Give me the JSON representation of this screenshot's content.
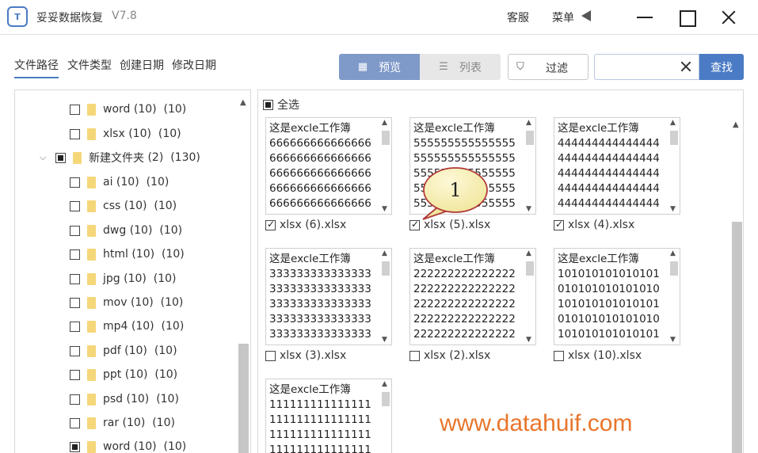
{
  "app": {
    "name": "妥妥数据恢复",
    "version": "V7.8",
    "logo_text": "T",
    "service": "客服",
    "menu": "菜单"
  },
  "tabs": [
    {
      "label": "文件路径"
    },
    {
      "label": "文件类型"
    },
    {
      "label": "创建日期"
    },
    {
      "label": "修改日期"
    }
  ],
  "toolbar": {
    "preview_label": "预览",
    "list_label": "列表",
    "filter_label": "过滤",
    "search_value": "",
    "search_label": "查找"
  },
  "tree": [
    {
      "name": "word",
      "count": "(10)",
      "total": "(10)"
    },
    {
      "name": "xlsx",
      "count": "(10)",
      "total": "(10)"
    },
    {
      "name": "新建文件夹",
      "count": "(2)",
      "total": "(130)"
    },
    {
      "name": "ai",
      "count": "(10)",
      "total": "(10)"
    },
    {
      "name": "css",
      "count": "(10)",
      "total": "(10)"
    },
    {
      "name": "dwg",
      "count": "(10)",
      "total": "(10)"
    },
    {
      "name": "html",
      "count": "(10)",
      "total": "(10)"
    },
    {
      "name": "jpg",
      "count": "(10)",
      "total": "(10)"
    },
    {
      "name": "mov",
      "count": "(10)",
      "total": "(10)"
    },
    {
      "name": "mp4",
      "count": "(10)",
      "total": "(10)"
    },
    {
      "name": "pdf",
      "count": "(10)",
      "total": "(10)"
    },
    {
      "name": "ppt",
      "count": "(10)",
      "total": "(10)"
    },
    {
      "name": "psd",
      "count": "(10)",
      "total": "(10)"
    },
    {
      "name": "rar",
      "count": "(10)",
      "total": "(10)"
    },
    {
      "name": "word",
      "count": "(10)",
      "total": "(10)"
    }
  ],
  "select_all_label": "全选",
  "files": [
    {
      "header": "这是excle工作簿",
      "lines": [
        "666666666666666",
        "666666666666666",
        "666666666666666",
        "666666666666666",
        "666666666666666"
      ],
      "name": "xlsx (6).xlsx",
      "checked": true
    },
    {
      "header": "这是excle工作簿",
      "lines": [
        "555555555555555",
        "555555555555555",
        "555555555555555",
        "555555555555555",
        "555555555555555"
      ],
      "name": "xlsx (5).xlsx",
      "checked": true
    },
    {
      "header": "这是excle工作簿",
      "lines": [
        "444444444444444",
        "444444444444444",
        "444444444444444",
        "444444444444444",
        "444444444444444"
      ],
      "name": "xlsx (4).xlsx",
      "checked": true
    },
    {
      "header": "这是excle工作簿",
      "lines": [
        "333333333333333",
        "333333333333333",
        "333333333333333",
        "333333333333333",
        "333333333333333"
      ],
      "name": "xlsx (3).xlsx",
      "checked": false
    },
    {
      "header": "这是excle工作簿",
      "lines": [
        "222222222222222",
        "222222222222222",
        "222222222222222",
        "222222222222222",
        "222222222222222"
      ],
      "name": "xlsx (2).xlsx",
      "checked": false
    },
    {
      "header": "这是excle工作簿",
      "lines": [
        "101010101010101",
        "010101010101010",
        "101010101010101",
        "010101010101010",
        "101010101010101"
      ],
      "name": "xlsx (10).xlsx",
      "checked": false
    },
    {
      "header": "这是excle工作簿",
      "lines": [
        "111111111111111",
        "111111111111111",
        "111111111111111",
        "111111111111111"
      ],
      "name": "",
      "checked": false
    }
  ],
  "callout_number": "1",
  "watermark": "www.datahuif.com",
  "colors": {
    "accent": "#4a7bc4",
    "view_active": "#7f9ac9",
    "folder": "#f5d77a",
    "watermark": "#e8762c"
  }
}
